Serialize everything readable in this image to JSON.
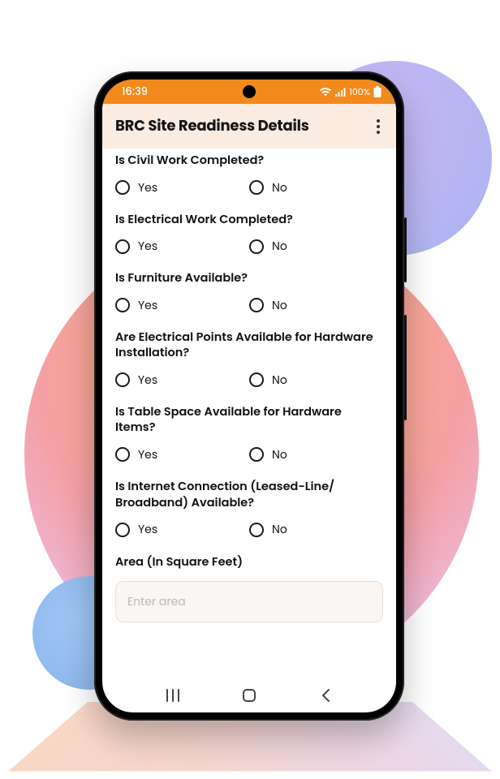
{
  "status": {
    "time": "16:39",
    "battery_text": "100%"
  },
  "header": {
    "title": "BRC Site Readiness Details"
  },
  "questions": [
    {
      "label": "Is Civil Work Completed?",
      "yes": "Yes",
      "no": "No"
    },
    {
      "label": "Is Electrical Work Completed?",
      "yes": "Yes",
      "no": "No"
    },
    {
      "label": "Is Furniture Available?",
      "yes": "Yes",
      "no": "No"
    },
    {
      "label": "Are Electrical Points Available for Hardware Installation?",
      "yes": "Yes",
      "no": "No"
    },
    {
      "label": "Is Table Space Available for Hardware Items?",
      "yes": "Yes",
      "no": "No"
    },
    {
      "label": "Is Internet Connection (Leased-Line/ Broadband) Available?",
      "yes": "Yes",
      "no": "No"
    }
  ],
  "area_field": {
    "label": "Area (In Square Feet)",
    "placeholder": "Enter area"
  }
}
